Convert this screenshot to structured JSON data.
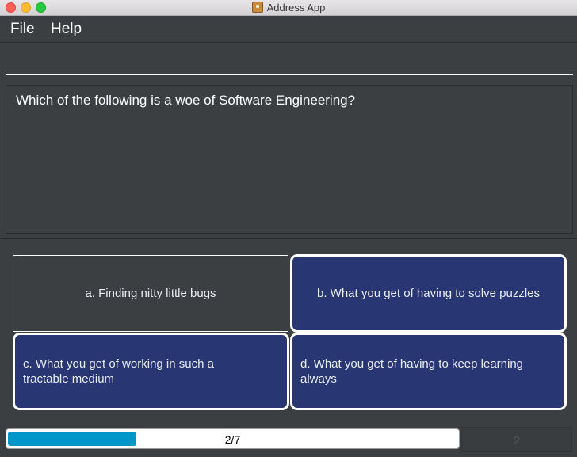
{
  "window": {
    "title": "Address App"
  },
  "menu": {
    "file": "File",
    "help": "Help"
  },
  "command": {
    "value": "",
    "placeholder": ""
  },
  "question": {
    "text": "Which of the following is a woe of Software Engineering?"
  },
  "options": [
    {
      "label": "a. Finding nitty little bugs",
      "state": "selected"
    },
    {
      "label": "b. What you get of having to solve puzzles",
      "state": "default"
    },
    {
      "label": "c. What you get of working in such a tractable medium",
      "state": "default"
    },
    {
      "label": "d. What you get of having to keep learning always",
      "state": "default"
    }
  ],
  "progress": {
    "label": "2/7",
    "fraction": 0.285
  },
  "score": {
    "value": "2"
  },
  "colors": {
    "background": "#3c3f41",
    "option_blue": "#283673",
    "progress_fill": "#0096c9"
  },
  "icons": {
    "app": "address-book-icon"
  }
}
